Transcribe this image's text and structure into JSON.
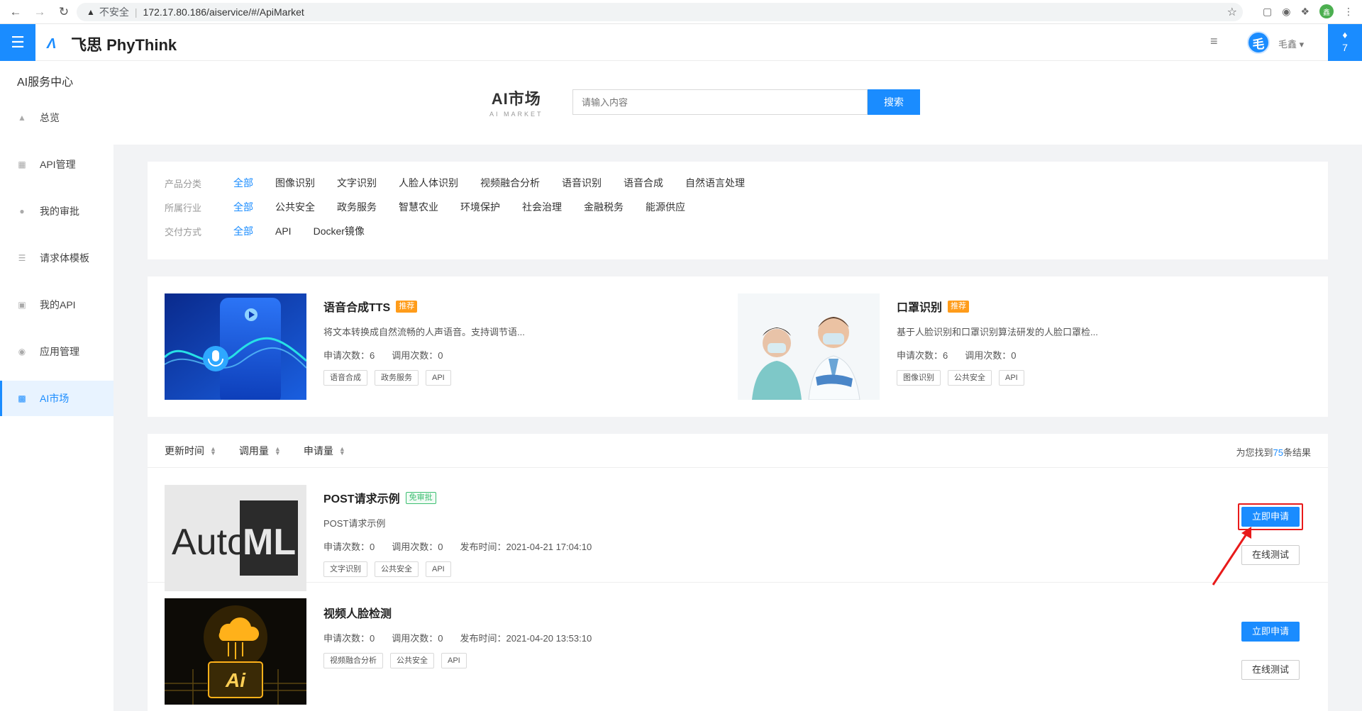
{
  "browser": {
    "security": "不安全",
    "url": "172.17.80.186/aiservice/#/ApiMarket",
    "profile_initial": "鑫"
  },
  "header": {
    "logo_text": "飞思 PhyThink",
    "user_avatar": "毛",
    "user_name": "毛鑫",
    "notification_count": "7"
  },
  "sidebar": {
    "title": "AI服务中心",
    "items": [
      {
        "label": "总览",
        "icon": "home-icon"
      },
      {
        "label": "API管理",
        "icon": "grid-icon"
      },
      {
        "label": "我的审批",
        "icon": "user-icon"
      },
      {
        "label": "请求体模板",
        "icon": "layers-icon"
      },
      {
        "label": "我的API",
        "icon": "bot-icon"
      },
      {
        "label": "应用管理",
        "icon": "user-circle-icon"
      },
      {
        "label": "AI市场",
        "icon": "market-icon",
        "active": true
      }
    ]
  },
  "hero": {
    "title": "AI市场",
    "subtitle": "AI MARKET",
    "search_placeholder": "请输入内容",
    "search_button": "搜索"
  },
  "filters": [
    {
      "label": "产品分类",
      "options": [
        "全部",
        "图像识别",
        "文字识别",
        "人脸人体识别",
        "视频融合分析",
        "语音识别",
        "语音合成",
        "自然语言处理"
      ],
      "selected": 0
    },
    {
      "label": "所属行业",
      "options": [
        "全部",
        "公共安全",
        "政务服务",
        "智慧农业",
        "环境保护",
        "社会治理",
        "金融税务",
        "能源供应"
      ],
      "selected": 0
    },
    {
      "label": "交付方式",
      "options": [
        "全部",
        "API",
        "Docker镜像"
      ],
      "selected": 0
    }
  ],
  "featured": [
    {
      "title": "语音合成TTS",
      "badge": "推荐",
      "desc": "将文本转换成自然流畅的人声语音。支持调节语...",
      "apply_count": "申请次数：6",
      "call_count": "调用次数：0",
      "tags": [
        "语音合成",
        "政务服务",
        "API"
      ]
    },
    {
      "title": "口罩识别",
      "badge": "推荐",
      "desc": "基于人脸识别和口罩识别算法研发的人脸口罩检...",
      "apply_count": "申请次数：6",
      "call_count": "调用次数：0",
      "tags": [
        "图像识别",
        "公共安全",
        "API"
      ]
    }
  ],
  "sort": {
    "options": [
      "更新时间",
      "调用量",
      "申请量"
    ],
    "result_prefix": "为您找到",
    "result_count": "75",
    "result_suffix": "条结果"
  },
  "list": [
    {
      "title": "POST请求示例",
      "badge": "免审批",
      "desc": "POST请求示例",
      "apply_count": "申请次数：0",
      "call_count": "调用次数：0",
      "published": "发布时间：2021-04-21 17:04:10",
      "tags": [
        "文字识别",
        "公共安全",
        "API"
      ],
      "thumb_text_a": "Auto",
      "thumb_text_b": "ML",
      "apply_button": "立即申请",
      "test_button": "在线测试"
    },
    {
      "title": "视频人脸检测",
      "apply_count": "申请次数：0",
      "call_count": "调用次数：0",
      "published": "发布时间：2021-04-20 13:53:10",
      "tags": [
        "视频融合分析",
        "公共安全",
        "API"
      ],
      "thumb_text": "Ai",
      "apply_button": "立即申请",
      "test_button": "在线测试"
    }
  ],
  "colors": {
    "primary": "#1a8cff",
    "recommend_badge": "#ff9c1a",
    "free_badge": "#3dbf72",
    "highlight": "#e81a1a"
  }
}
